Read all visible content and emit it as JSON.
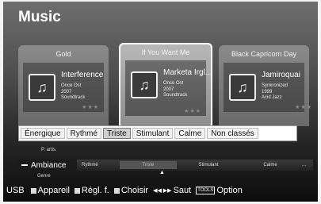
{
  "app": {
    "title": "Music"
  },
  "cards": [
    {
      "header": "Gold",
      "song": "Interference",
      "meta": [
        "Once Ost",
        "2007",
        "Soundtrack"
      ],
      "stars": "★★★"
    },
    {
      "header": "If You Want Me",
      "song": "Marketa Irgl...",
      "meta": [
        "Once Ost",
        "2007",
        "Soundtrack"
      ],
      "stars": "★★★"
    },
    {
      "header": "Black Capricorn Day",
      "song": "Jamiroquai",
      "meta": [
        "Synkronized",
        "1999",
        "Acid Jazz"
      ],
      "stars": "★★★"
    }
  ],
  "moods": [
    "Énergique",
    "Rythmé",
    "Triste",
    "Stimulant",
    "Calme",
    "Non classés"
  ],
  "selected_mood": "Triste",
  "category": {
    "up_label": "P. artis.",
    "current": "Ambiance",
    "items": [
      "Rythmé",
      "Triste",
      "Stimulant",
      "Calme"
    ],
    "more": "...",
    "down_label": "Genre",
    "arrow": "▲"
  },
  "footer": {
    "source": "USB",
    "device": "Appareil",
    "settings": "Régl. f.",
    "select": "Choisir",
    "jump_icon": "◀◀ ▶▶",
    "jump": "Saut",
    "tools_badge": "TOOLS",
    "option": "Option"
  }
}
